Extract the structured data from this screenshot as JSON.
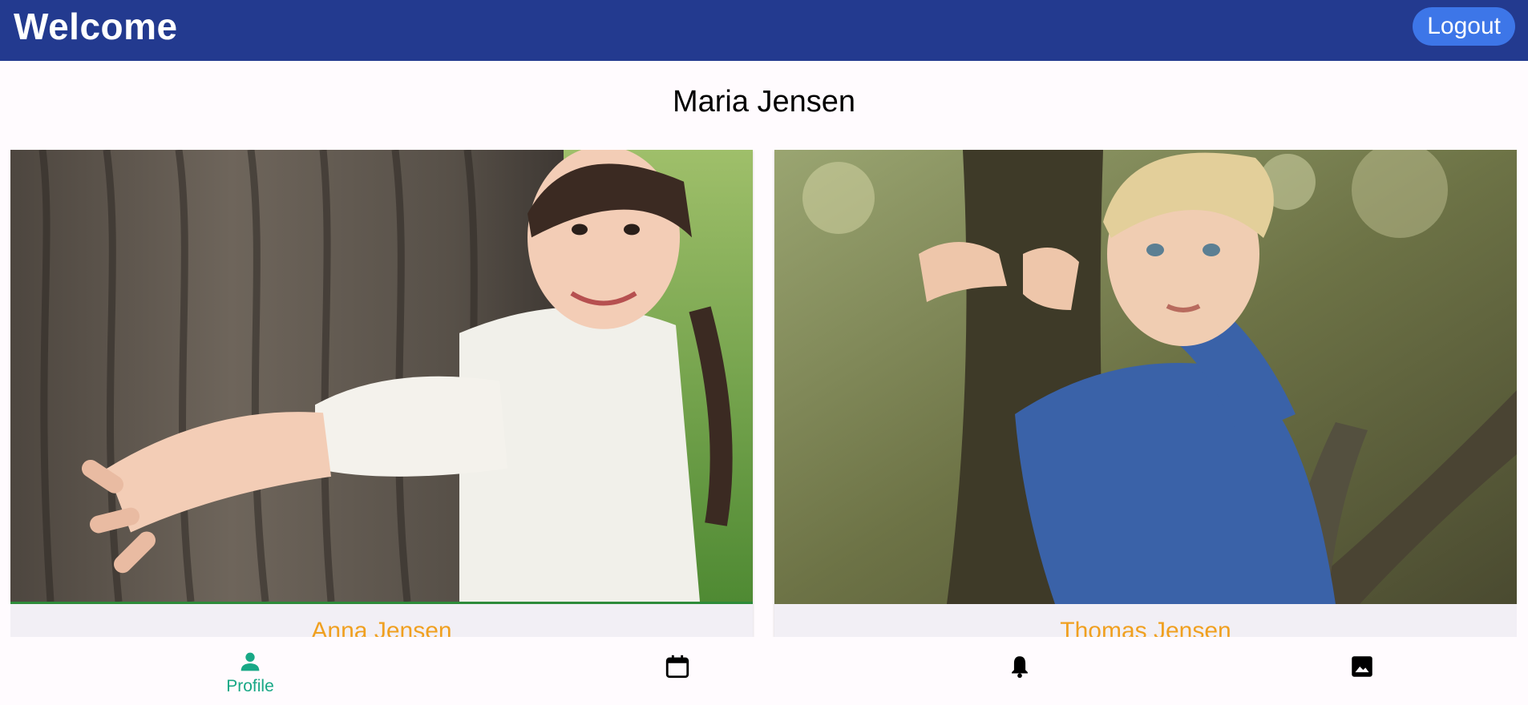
{
  "appbar": {
    "title": "Welcome",
    "logout_label": "Logout"
  },
  "parent": {
    "name": "Maria Jensen"
  },
  "children": [
    {
      "name": "Anna Jensen",
      "photo": "girl-hugging-tree-photo"
    },
    {
      "name": "Thomas Jensen",
      "photo": "boy-hugging-tree-photo"
    }
  ],
  "bottom_nav": {
    "items": [
      {
        "id": "profile",
        "label": "Profile",
        "icon": "person-icon",
        "active": true
      },
      {
        "id": "calendar",
        "label": "",
        "icon": "calendar-icon",
        "active": false
      },
      {
        "id": "notifications",
        "label": "",
        "icon": "bell-icon",
        "active": false
      },
      {
        "id": "gallery",
        "label": "",
        "icon": "image-icon",
        "active": false
      }
    ]
  },
  "colors": {
    "appbar": "#233a8f",
    "logout_button": "#3d76e8",
    "child_name": "#f0a020",
    "nav_active": "#18a886",
    "nav_inactive": "#000000"
  }
}
